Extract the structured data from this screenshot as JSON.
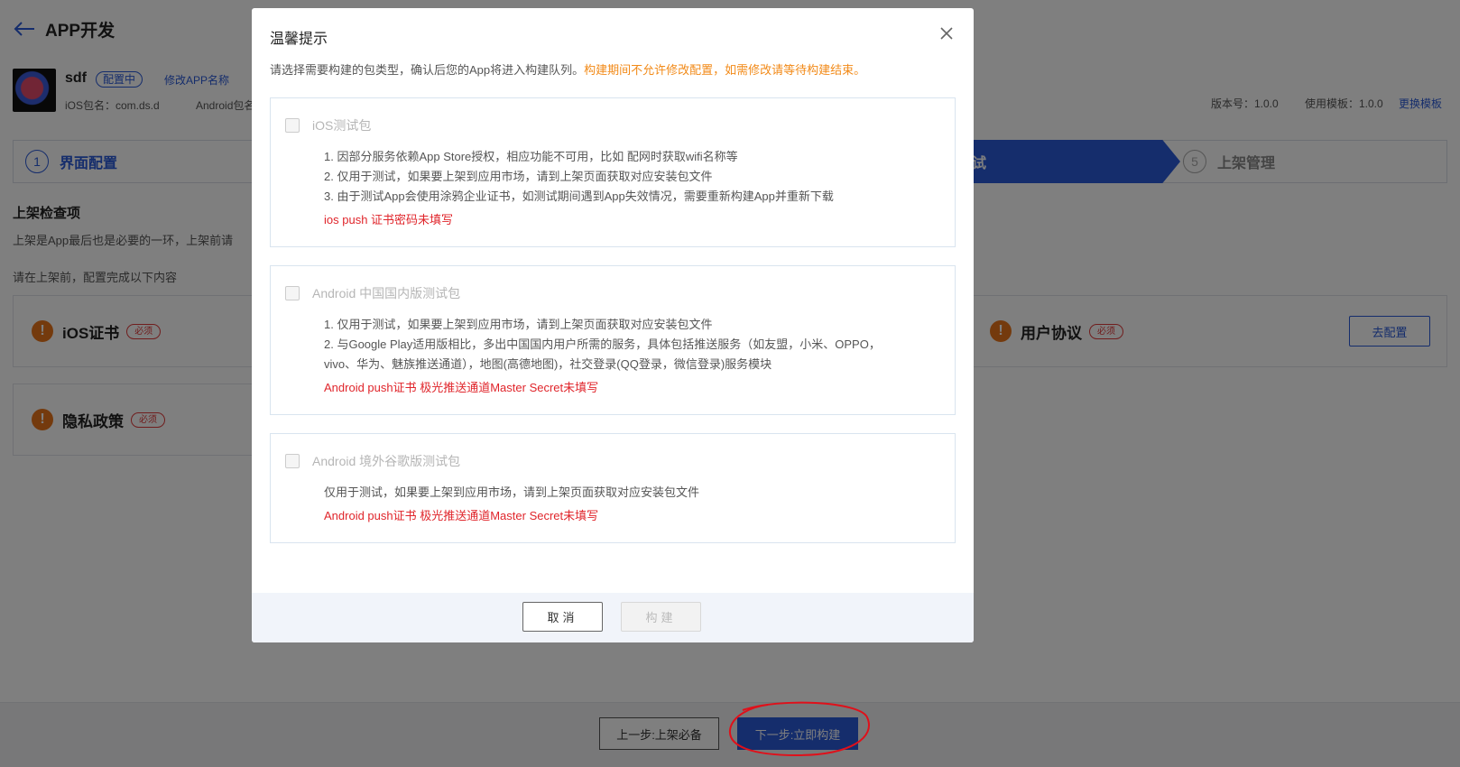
{
  "header": {
    "title": "APP开发",
    "back_icon": "arrow-left-icon"
  },
  "app": {
    "name": "sdf",
    "status": "配置中",
    "rename_link": "修改APP名称",
    "ios_package": "iOS包名：com.ds.d",
    "android_package": "Android包名",
    "version": "版本号：1.0.0",
    "template": "使用模板：1.0.0",
    "change_template": "更换模板"
  },
  "steps": {
    "step1": {
      "num": "1",
      "label": "界面配置"
    },
    "active": {
      "label": "测试"
    },
    "step5": {
      "num": "5",
      "label": "上架管理"
    }
  },
  "section": {
    "title": "上架检查项",
    "desc": "上架是App最后也是必要的一环，上架前请",
    "hint": "请在上架前，配置完成以下内容"
  },
  "cards": {
    "ios": {
      "name": "iOS证书",
      "badge": "必须"
    },
    "privacy": {
      "name": "隐私政策",
      "badge": "必须"
    },
    "user": {
      "name": "用户协议",
      "badge": "必须",
      "button": "去配置"
    }
  },
  "footer": {
    "prev": "上一步:上架必备",
    "next": "下一步:立即构建"
  },
  "modal": {
    "title": "温馨提示",
    "close_icon": "close-icon",
    "intro": "请选择需要构建的包类型，确认后您的App将进入构建队列。",
    "intro_warn": "构建期间不允许修改配置，如需修改请等待构建结束。",
    "packages": [
      {
        "name": "iOS测试包",
        "lines": [
          "1. 因部分服务依赖App Store授权，相应功能不可用，比如 配网时获取wifi名称等",
          "2. 仅用于测试，如果要上架到应用市场，请到上架页面获取对应安装包文件",
          "3. 由于测试App会使用涂鸦企业证书，如测试期间遇到App失效情况，需要重新构建App并重新下载"
        ],
        "error": "ios push 证书密码未填写"
      },
      {
        "name": "Android 中国国内版测试包",
        "lines": [
          "1. 仅用于测试，如果要上架到应用市场，请到上架页面获取对应安装包文件",
          "2. 与Google Play适用版相比，多出中国国内用户所需的服务，具体包括推送服务（如友盟，小米、OPPO，",
          "vivo、华为、魅族推送通道），地图(高德地图)，社交登录(QQ登录，微信登录)服务模块"
        ],
        "error": "Android push证书 极光推送通道Master Secret未填写"
      },
      {
        "name": "Android 境外谷歌版测试包",
        "lines": [
          "仅用于测试，如果要上架到应用市场，请到上架页面获取对应安装包文件"
        ],
        "error": "Android push证书 极光推送通道Master Secret未填写"
      }
    ],
    "cancel": "取消",
    "build": "构建"
  },
  "colors": {
    "accent": "#2a5ad8",
    "warning": "#f28a18",
    "error": "#e0252b",
    "annotation": "#e0101a"
  }
}
